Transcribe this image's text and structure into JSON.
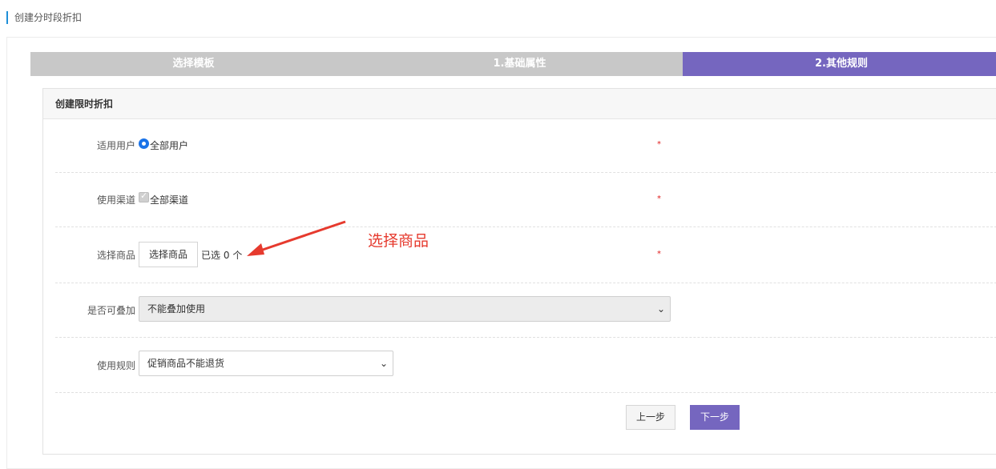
{
  "page_title": "创建分时段折扣",
  "steps": [
    {
      "label": "选择模板",
      "active": false
    },
    {
      "label": "1.基础属性",
      "active": false
    },
    {
      "label": "2.其他规则",
      "active": true
    }
  ],
  "panel_title": "创建限时折扣",
  "required_mark": "*",
  "form": {
    "user": {
      "label": "适用用户",
      "option": "全部用户"
    },
    "channel": {
      "label": "使用渠道",
      "option": "全部渠道"
    },
    "goods": {
      "label": "选择商品",
      "button": "选择商品",
      "selected_prefix": "已选",
      "selected_count": "0",
      "selected_unit": "个"
    },
    "stack": {
      "label": "是否可叠加",
      "value": "不能叠加使用"
    },
    "rule": {
      "label": "使用规则",
      "value": "促销商品不能退货"
    }
  },
  "buttons": {
    "prev": "上一步",
    "next": "下一步"
  },
  "annotation": "选择商品",
  "colors": {
    "accent": "#7566bf",
    "step_inactive": "#c8c8c8",
    "required": "#e02020",
    "annotation": "#e63a2e"
  }
}
